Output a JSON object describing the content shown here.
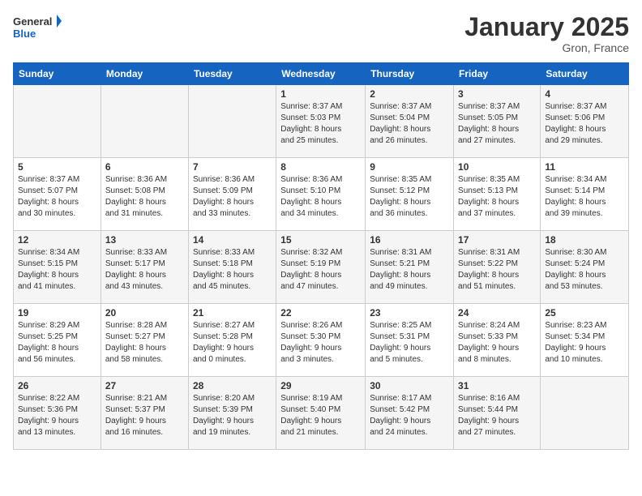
{
  "logo": {
    "general": "General",
    "blue": "Blue"
  },
  "header": {
    "month": "January 2025",
    "location": "Gron, France"
  },
  "weekdays": [
    "Sunday",
    "Monday",
    "Tuesday",
    "Wednesday",
    "Thursday",
    "Friday",
    "Saturday"
  ],
  "weeks": [
    [
      {
        "day": "",
        "info": ""
      },
      {
        "day": "",
        "info": ""
      },
      {
        "day": "",
        "info": ""
      },
      {
        "day": "1",
        "info": "Sunrise: 8:37 AM\nSunset: 5:03 PM\nDaylight: 8 hours\nand 25 minutes."
      },
      {
        "day": "2",
        "info": "Sunrise: 8:37 AM\nSunset: 5:04 PM\nDaylight: 8 hours\nand 26 minutes."
      },
      {
        "day": "3",
        "info": "Sunrise: 8:37 AM\nSunset: 5:05 PM\nDaylight: 8 hours\nand 27 minutes."
      },
      {
        "day": "4",
        "info": "Sunrise: 8:37 AM\nSunset: 5:06 PM\nDaylight: 8 hours\nand 29 minutes."
      }
    ],
    [
      {
        "day": "5",
        "info": "Sunrise: 8:37 AM\nSunset: 5:07 PM\nDaylight: 8 hours\nand 30 minutes."
      },
      {
        "day": "6",
        "info": "Sunrise: 8:36 AM\nSunset: 5:08 PM\nDaylight: 8 hours\nand 31 minutes."
      },
      {
        "day": "7",
        "info": "Sunrise: 8:36 AM\nSunset: 5:09 PM\nDaylight: 8 hours\nand 33 minutes."
      },
      {
        "day": "8",
        "info": "Sunrise: 8:36 AM\nSunset: 5:10 PM\nDaylight: 8 hours\nand 34 minutes."
      },
      {
        "day": "9",
        "info": "Sunrise: 8:35 AM\nSunset: 5:12 PM\nDaylight: 8 hours\nand 36 minutes."
      },
      {
        "day": "10",
        "info": "Sunrise: 8:35 AM\nSunset: 5:13 PM\nDaylight: 8 hours\nand 37 minutes."
      },
      {
        "day": "11",
        "info": "Sunrise: 8:34 AM\nSunset: 5:14 PM\nDaylight: 8 hours\nand 39 minutes."
      }
    ],
    [
      {
        "day": "12",
        "info": "Sunrise: 8:34 AM\nSunset: 5:15 PM\nDaylight: 8 hours\nand 41 minutes."
      },
      {
        "day": "13",
        "info": "Sunrise: 8:33 AM\nSunset: 5:17 PM\nDaylight: 8 hours\nand 43 minutes."
      },
      {
        "day": "14",
        "info": "Sunrise: 8:33 AM\nSunset: 5:18 PM\nDaylight: 8 hours\nand 45 minutes."
      },
      {
        "day": "15",
        "info": "Sunrise: 8:32 AM\nSunset: 5:19 PM\nDaylight: 8 hours\nand 47 minutes."
      },
      {
        "day": "16",
        "info": "Sunrise: 8:31 AM\nSunset: 5:21 PM\nDaylight: 8 hours\nand 49 minutes."
      },
      {
        "day": "17",
        "info": "Sunrise: 8:31 AM\nSunset: 5:22 PM\nDaylight: 8 hours\nand 51 minutes."
      },
      {
        "day": "18",
        "info": "Sunrise: 8:30 AM\nSunset: 5:24 PM\nDaylight: 8 hours\nand 53 minutes."
      }
    ],
    [
      {
        "day": "19",
        "info": "Sunrise: 8:29 AM\nSunset: 5:25 PM\nDaylight: 8 hours\nand 56 minutes."
      },
      {
        "day": "20",
        "info": "Sunrise: 8:28 AM\nSunset: 5:27 PM\nDaylight: 8 hours\nand 58 minutes."
      },
      {
        "day": "21",
        "info": "Sunrise: 8:27 AM\nSunset: 5:28 PM\nDaylight: 9 hours\nand 0 minutes."
      },
      {
        "day": "22",
        "info": "Sunrise: 8:26 AM\nSunset: 5:30 PM\nDaylight: 9 hours\nand 3 minutes."
      },
      {
        "day": "23",
        "info": "Sunrise: 8:25 AM\nSunset: 5:31 PM\nDaylight: 9 hours\nand 5 minutes."
      },
      {
        "day": "24",
        "info": "Sunrise: 8:24 AM\nSunset: 5:33 PM\nDaylight: 9 hours\nand 8 minutes."
      },
      {
        "day": "25",
        "info": "Sunrise: 8:23 AM\nSunset: 5:34 PM\nDaylight: 9 hours\nand 10 minutes."
      }
    ],
    [
      {
        "day": "26",
        "info": "Sunrise: 8:22 AM\nSunset: 5:36 PM\nDaylight: 9 hours\nand 13 minutes."
      },
      {
        "day": "27",
        "info": "Sunrise: 8:21 AM\nSunset: 5:37 PM\nDaylight: 9 hours\nand 16 minutes."
      },
      {
        "day": "28",
        "info": "Sunrise: 8:20 AM\nSunset: 5:39 PM\nDaylight: 9 hours\nand 19 minutes."
      },
      {
        "day": "29",
        "info": "Sunrise: 8:19 AM\nSunset: 5:40 PM\nDaylight: 9 hours\nand 21 minutes."
      },
      {
        "day": "30",
        "info": "Sunrise: 8:17 AM\nSunset: 5:42 PM\nDaylight: 9 hours\nand 24 minutes."
      },
      {
        "day": "31",
        "info": "Sunrise: 8:16 AM\nSunset: 5:44 PM\nDaylight: 9 hours\nand 27 minutes."
      },
      {
        "day": "",
        "info": ""
      }
    ]
  ]
}
